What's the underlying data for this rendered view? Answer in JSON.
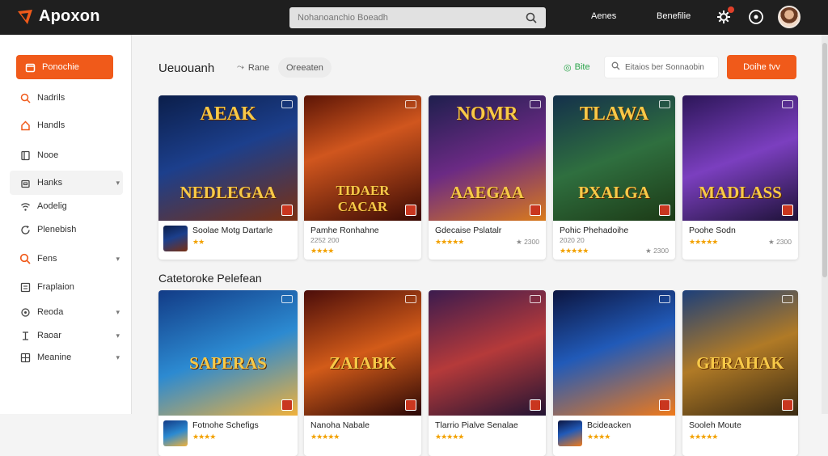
{
  "app": {
    "logo_text": "Apoxon",
    "brand_color": "#f05a1a"
  },
  "topbar": {
    "search_placeholder": "Nohanoanchio Boeadh",
    "links": [
      "Aenes",
      "Benefilie"
    ],
    "icons": [
      "settings-cog-icon",
      "circle-target-icon"
    ],
    "notification_badge_color": "#e0402a"
  },
  "sidebar": {
    "items": [
      {
        "label": "Ponochie",
        "icon": "home-icon",
        "active": true
      },
      {
        "label": "Nadrils",
        "icon": "search-icon"
      },
      {
        "label": "Handls",
        "icon": "tag-icon"
      },
      {
        "label": "Nooe",
        "icon": "book-icon"
      },
      {
        "label": "Hanks",
        "icon": "bag-icon",
        "chevron": true,
        "hover": true
      },
      {
        "label": "Aodelig",
        "icon": "wifi-icon"
      },
      {
        "label": "Plenebish",
        "icon": "refresh-icon"
      },
      {
        "label": "Fens",
        "icon": "search-icon",
        "chevron": true
      },
      {
        "label": "Fraplaion",
        "icon": "list-icon"
      },
      {
        "label": "Reoda",
        "icon": "ring-icon",
        "chevron": true
      },
      {
        "label": "Raoar",
        "icon": "pin-icon",
        "chevron": true
      },
      {
        "label": "Meanine",
        "icon": "grid-icon",
        "chevron": true
      }
    ]
  },
  "main": {
    "page_title": "Ueuouanh",
    "chips": [
      "Rane",
      "Oreeaten"
    ],
    "beta_label": "Bite",
    "filter_placeholder": "Eitaios ber Sonnaobin",
    "cta_label": "Doihe tvv",
    "section_title": "Catetoroke Pelefean"
  },
  "row1": [
    {
      "art_title": "AEAK",
      "art_sub": "NEDLEGAA",
      "name": "Soolae Motg Dartarle",
      "meta_left": "",
      "meta_right": "",
      "stars": "★★",
      "bg": "linear-gradient(160deg,#0b1e4a 0%,#1c3f8c 45%,#7a3012 100%)"
    },
    {
      "art_title": "",
      "art_sub": "TIDAER CACAR",
      "name": "Pamhe Ronhahne",
      "meta_left": "2252 200",
      "meta_right": "",
      "stars": "★★★★",
      "bg": "linear-gradient(160deg,#5c1506 0%,#d0561e 40%,#3b0a04 100%)"
    },
    {
      "art_title": "NOMR",
      "art_sub": "AAEGAA",
      "name": "Gdecaise Pslatalr",
      "meta_left": "",
      "meta_right": "★ 2300",
      "stars": "★★★★★",
      "bg": "linear-gradient(160deg,#1e1f4d 0%,#6b2a84 50%,#d97a1c 100%)"
    },
    {
      "art_title": "TLAWA",
      "art_sub": "PXALGA",
      "name": "Pohic Phehadoihe",
      "meta_left": "2020 20",
      "meta_right": "★ 2300",
      "stars": "★★★★★",
      "bg": "linear-gradient(160deg,#14304b 0%,#2f6f3f 50%,#1c3a16 100%)"
    },
    {
      "art_title": "",
      "art_sub": "MADLASS",
      "name": "Poohe Sodn",
      "meta_left": "",
      "meta_right": "★ 2300",
      "stars": "★★★★★",
      "bg": "linear-gradient(160deg,#2c1658 0%,#7b3fbf 50%,#1e1238 100%)"
    }
  ],
  "row2": [
    {
      "art_title": "",
      "art_sub": "SAPERAS",
      "name": "Fotnohe Schefigs",
      "stars": "★★★★",
      "bg": "linear-gradient(160deg,#123b86 0%,#2c8ad1 50%,#f0b13b 100%)"
    },
    {
      "art_title": "",
      "art_sub": "ZAIABK",
      "name": "Nanoha Nabale",
      "stars": "★★★★★",
      "bg": "linear-gradient(160deg,#4b0d0a 0%,#d25b19 50%,#2a0706 100%)"
    },
    {
      "art_title": "",
      "art_sub": "",
      "name": "Tlarrio Pialve Senalae",
      "stars": "★★★★★",
      "bg": "linear-gradient(160deg,#3b1b4e 0%,#b53a3a 50%,#231433 100%)"
    },
    {
      "art_title": "",
      "art_sub": "",
      "name": "Bcideacken",
      "stars": "★★★★",
      "bg": "linear-gradient(160deg,#0c1540 0%,#215ab8 45%,#f07a1a 100%)"
    },
    {
      "art_title": "",
      "art_sub": "GERAHAK",
      "name": "Sooleh Moute",
      "stars": "★★★★★",
      "bg": "linear-gradient(160deg,#1c3f7a 0%,#b07a26 50%,#3a2a12 100%)"
    }
  ]
}
